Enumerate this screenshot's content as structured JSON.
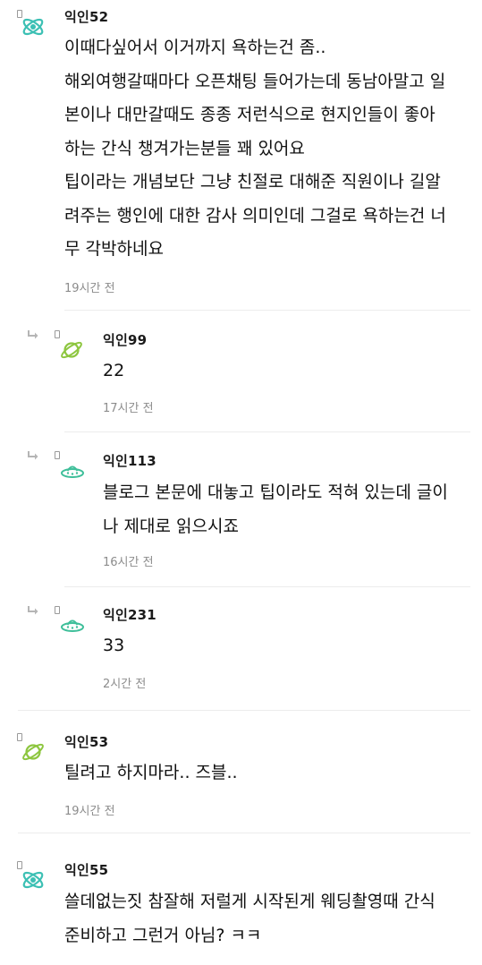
{
  "comments": [
    {
      "id": "c52",
      "nickname": "익인52",
      "avatar_icon": "atom-icon",
      "is_reply": false,
      "lines": [
        "이때다싶어서 이거까지 욕하는건 좀..",
        "해외여행갈때마다 오픈채팅 들어가는데 동남아말고 일",
        "본이나 대만갈때도 종종 저런식으로 현지인들이 좋아",
        "하는 간식 챙겨가는분들 꽤 있어요",
        "팁이라는 개념보단 그냥 친절로 대해준 직원이나 길알",
        "려주는 행인에 대한 감사 의미인데 그걸로 욕하는건 너",
        "무 각박하네요"
      ],
      "time": "19시간 전"
    },
    {
      "id": "c99",
      "nickname": "익인99",
      "avatar_icon": "planet-icon",
      "is_reply": true,
      "lines": [
        "22"
      ],
      "time": "17시간 전"
    },
    {
      "id": "c113",
      "nickname": "익인113",
      "avatar_icon": "ufo-icon",
      "is_reply": true,
      "lines": [
        "블로그 본문에 대놓고 팁이라도 적혀 있는데 글이",
        "나 제대로 읽으시죠"
      ],
      "time": "16시간 전"
    },
    {
      "id": "c231",
      "nickname": "익인231",
      "avatar_icon": "ufo-icon",
      "is_reply": true,
      "lines": [
        "33"
      ],
      "time": "2시간 전"
    },
    {
      "id": "c53",
      "nickname": "익인53",
      "avatar_icon": "planet-icon",
      "is_reply": false,
      "lines": [
        "틸려고 하지마라.. 즈블.."
      ],
      "time": "19시간 전"
    },
    {
      "id": "c55",
      "nickname": "익인55",
      "avatar_icon": "atom-icon",
      "is_reply": false,
      "lines": [
        "쓸데없는짓 참잘해 저럴게 시작된게 웨딩촬영때 간식",
        "준비하고 그런거 아님? ㅋㅋ"
      ],
      "time": ""
    }
  ],
  "colors": {
    "atom": "#3cc0b4",
    "planet": "#8dc63f",
    "ufo": "#3fbf9a",
    "meta": "#8c8c8c",
    "reply_arrow": "#b5b5b5",
    "divider": "#ececec"
  }
}
